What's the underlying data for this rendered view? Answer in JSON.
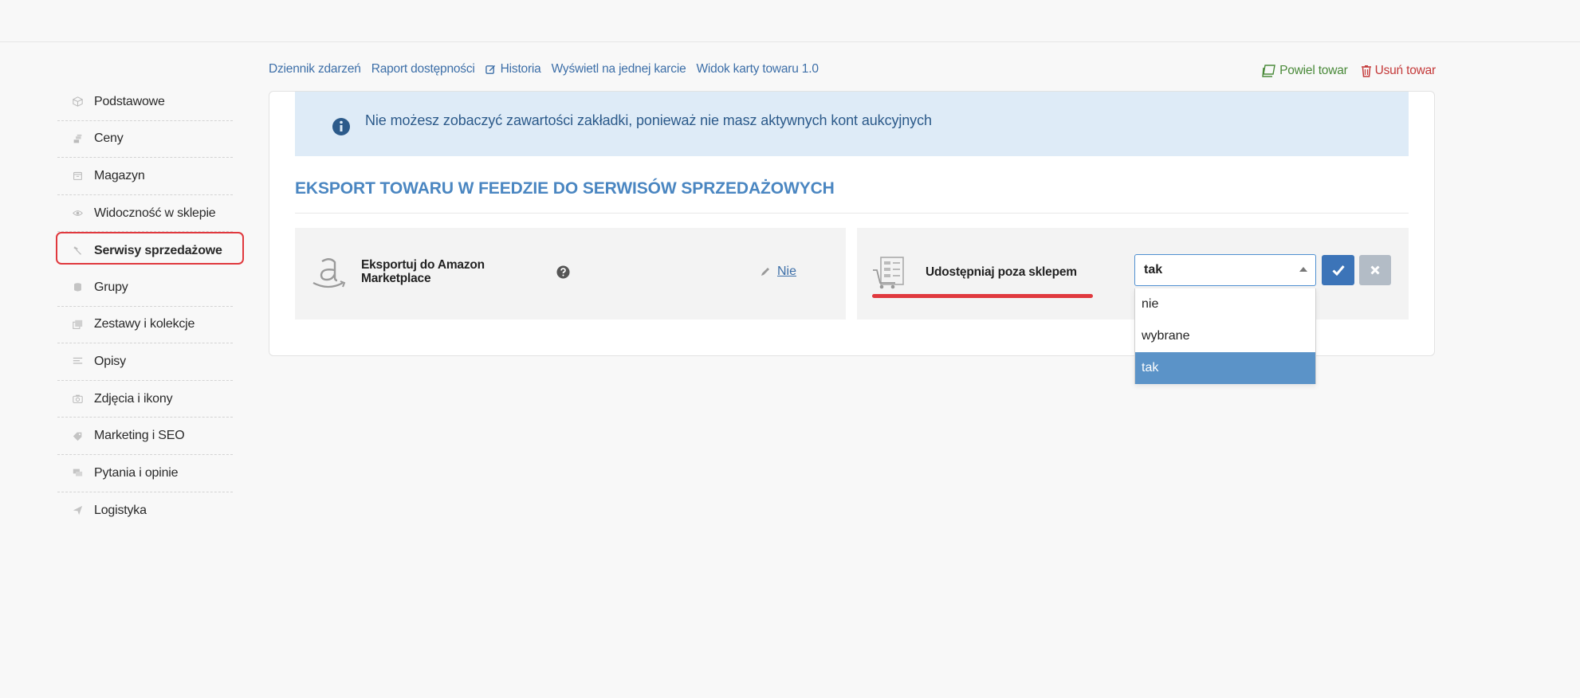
{
  "sidebar": {
    "items": [
      {
        "label": "Podstawowe",
        "icon": "cube-icon"
      },
      {
        "label": "Ceny",
        "icon": "coins-icon"
      },
      {
        "label": "Magazyn",
        "icon": "box-icon"
      },
      {
        "label": "Widoczność w sklepie",
        "icon": "eye-icon"
      },
      {
        "label": "Serwisy sprzedażowe",
        "icon": "gavel-icon",
        "active": true
      },
      {
        "label": "Grupy",
        "icon": "database-icon"
      },
      {
        "label": "Zestawy i kolekcje",
        "icon": "collection-icon"
      },
      {
        "label": "Opisy",
        "icon": "text-lines-icon"
      },
      {
        "label": "Zdjęcia i ikony",
        "icon": "camera-icon"
      },
      {
        "label": "Marketing i SEO",
        "icon": "tag-icon"
      },
      {
        "label": "Pytania i opinie",
        "icon": "comments-icon"
      },
      {
        "label": "Logistyka",
        "icon": "paper-plane-icon"
      }
    ]
  },
  "toplinks": {
    "event_log": "Dziennik zdarzeń",
    "availability_report": "Raport dostępności",
    "history": "Historia",
    "single_card": "Wyświetl na jednej karcie",
    "card_view": "Widok karty towaru 1.0"
  },
  "actions": {
    "duplicate": "Powiel towar",
    "delete": "Usuń towar"
  },
  "alert": {
    "text": "Nie możesz zobaczyć zawartości zakładki, ponieważ nie masz aktywnych kont aukcyjnych"
  },
  "section": {
    "title": "EKSPORT TOWARU W FEEDZIE DO SERWISÓW SPRZEDAŻOWYCH"
  },
  "amazon": {
    "label": "Eksportuj do Amazon Marketplace",
    "value": "Nie"
  },
  "share": {
    "label": "Udostępniaj poza sklepem",
    "selected": "tak",
    "options": [
      "nie",
      "wybrane",
      "tak"
    ]
  },
  "colors": {
    "accent": "#3d6fa8",
    "highlight": "#e0393e",
    "selected_option": "#5b93c8",
    "alert_bg": "#deebf7"
  }
}
